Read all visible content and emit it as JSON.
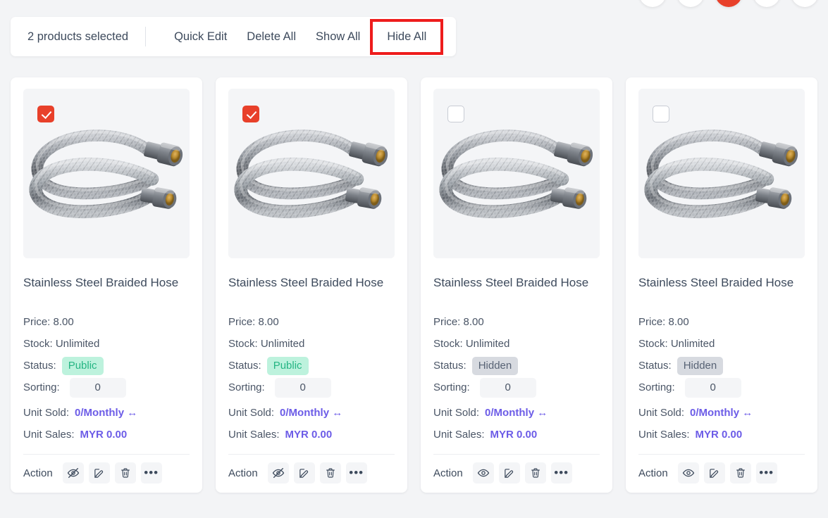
{
  "colors": {
    "page_bg": "#f3f4f6",
    "accent_red": "#e8402a",
    "highlight_outline": "#ee1c1c",
    "link_purple": "#6c5ce7",
    "badge_public_bg": "#bdf2dd",
    "badge_public_text": "#25b583",
    "badge_hidden_bg": "#d7dae0",
    "badge_hidden_text": "#586375"
  },
  "fabs": [
    {
      "name": "fab-1",
      "color": "#ffffff"
    },
    {
      "name": "fab-2",
      "color": "#ffffff"
    },
    {
      "name": "fab-3",
      "color": "#e8402a"
    },
    {
      "name": "fab-4",
      "color": "#ffffff"
    },
    {
      "name": "fab-5",
      "color": "#ffffff"
    }
  ],
  "toolbar": {
    "selection_label": "2 products selected",
    "quick_edit_label": "Quick Edit",
    "delete_all_label": "Delete All",
    "show_all_label": "Show All",
    "hide_all_label": "Hide All"
  },
  "labels": {
    "price_prefix": "Price:",
    "stock_prefix": "Stock:",
    "status_prefix": "Status:",
    "sorting_prefix": "Sorting:",
    "unit_sold_prefix": "Unit Sold:",
    "unit_sales_prefix": "Unit Sales:",
    "action_label": "Action",
    "more_glyph": "•••"
  },
  "products": [
    {
      "title": "Stainless Steel Braided Hose",
      "price": "8.00",
      "stock": "Unlimited",
      "status": "Public",
      "sorting": "0",
      "unit_sold": "0/Monthly ↔",
      "unit_sales": "MYR 0.00",
      "selected": true,
      "visibility_icon": "eye-off-icon"
    },
    {
      "title": "Stainless Steel Braided Hose",
      "price": "8.00",
      "stock": "Unlimited",
      "status": "Public",
      "sorting": "0",
      "unit_sold": "0/Monthly ↔",
      "unit_sales": "MYR 0.00",
      "selected": true,
      "visibility_icon": "eye-off-icon"
    },
    {
      "title": "Stainless Steel Braided Hose",
      "price": "8.00",
      "stock": "Unlimited",
      "status": "Hidden",
      "sorting": "0",
      "unit_sold": "0/Monthly ↔",
      "unit_sales": "MYR 0.00",
      "selected": false,
      "visibility_icon": "eye-icon"
    },
    {
      "title": "Stainless Steel Braided Hose",
      "price": "8.00",
      "stock": "Unlimited",
      "status": "Hidden",
      "sorting": "0",
      "unit_sold": "0/Monthly ↔",
      "unit_sales": "MYR 0.00",
      "selected": false,
      "visibility_icon": "eye-icon"
    }
  ]
}
